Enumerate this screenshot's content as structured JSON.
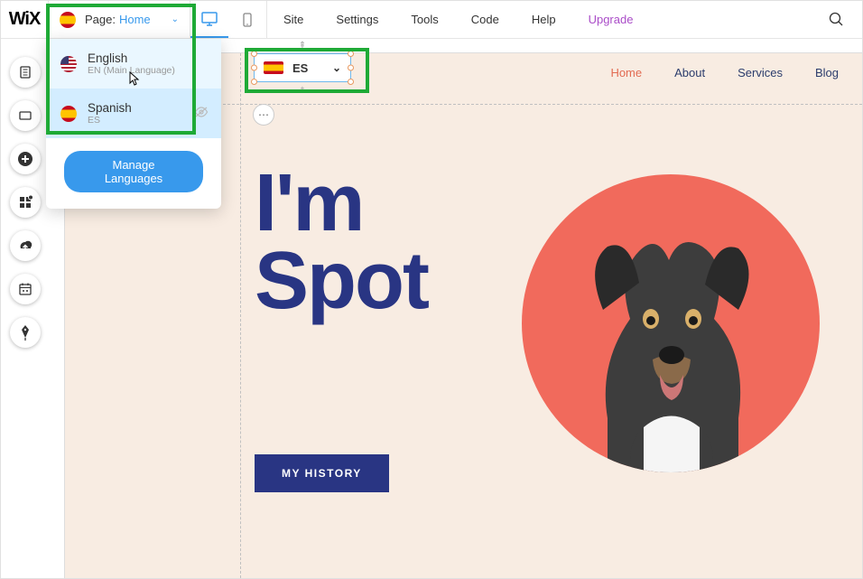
{
  "logo": "WiX",
  "pageSelector": {
    "label": "Page:",
    "name": "Home"
  },
  "topMenu": [
    "Site",
    "Settings",
    "Tools",
    "Code",
    "Help",
    "Upgrade"
  ],
  "languageDropdown": {
    "items": [
      {
        "name": "English",
        "sub": "EN (Main Language)"
      },
      {
        "name": "Spanish",
        "sub": "ES"
      }
    ],
    "manageLabel": "Manage Languages"
  },
  "siteNav": [
    "Home",
    "About",
    "Services",
    "Blog"
  ],
  "esWidget": {
    "label": "ES"
  },
  "hero": {
    "line1": "I'm",
    "line2": "Spot"
  },
  "historyButton": "MY HISTORY"
}
